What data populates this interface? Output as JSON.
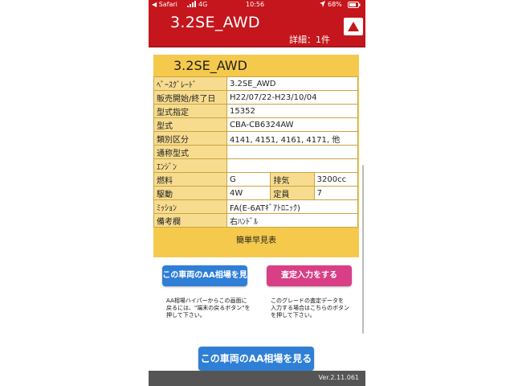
{
  "statusbar": {
    "carrier": "◀ Safari",
    "network": "4G",
    "time": "10:56",
    "battery": "68%"
  },
  "header": {
    "title": "3.2SE_AWD",
    "count": "詳細：1件"
  },
  "card": {
    "title": "3.2SE_AWD",
    "rows": {
      "base_grade": {
        "label": "ﾍﾞｰｽｸﾞﾚｰﾄﾞ",
        "value": "3.2SE_AWD"
      },
      "sales_period": {
        "label": "販売開始/終了日",
        "value": "H22/07/22-H23/10/04"
      },
      "model_designation": {
        "label": "型式指定",
        "value": "15352"
      },
      "model": {
        "label": "型式",
        "value": "CBA-CB6324AW"
      },
      "category": {
        "label": "類別区分",
        "value": "4141, 4151, 4161, 4171, 他"
      },
      "common_model": {
        "label": "通称型式",
        "value": ""
      },
      "engine": {
        "label": "ｴﾝｼﾞﾝ",
        "value": ""
      },
      "fuel": {
        "label": "燃料",
        "value": "G",
        "label2": "排気",
        "value2": "3200cc"
      },
      "drive": {
        "label": "駆動",
        "value": "4W",
        "label2": "定員",
        "value2": "7"
      },
      "transmission": {
        "label": "ﾐｯｼｮﾝ",
        "value": "FA(E-6ATｷﾞｱﾄﾛﾆｯｸ)"
      },
      "remarks": {
        "label": "備考欄",
        "value": "右ﾊﾝﾄﾞﾙ"
      }
    },
    "simple_table": "簡単早見表"
  },
  "buttons": {
    "aa_market": "この車両のAA相場を見る",
    "satei_input": "査定入力をする",
    "aa_market_big": "この車両のAA相場を見る"
  },
  "notes": {
    "left": "AA相場ハイパーからこの画面に\n戻るには、\"端末の戻るボタン\"を\n押して下さい。",
    "right": "このグレードの査定データを\n入力する場合はこちらのボタン\nを押して下さい。"
  },
  "footer": {
    "version": "Ver.2.11.061"
  },
  "colors": {
    "header_red": "#c4161c",
    "card_yellow": "#f5c94c",
    "button_blue": "#2f7fd6",
    "button_pink": "#d93f86"
  }
}
